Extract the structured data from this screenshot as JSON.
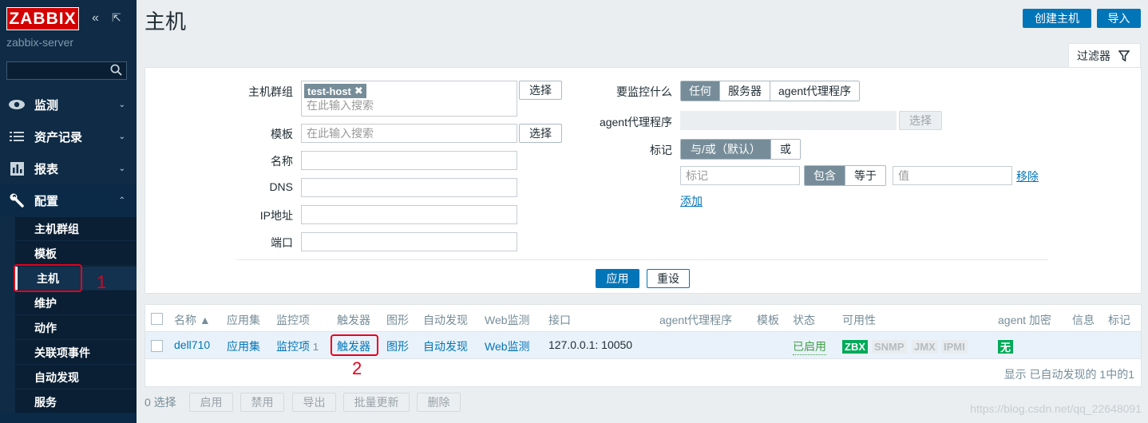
{
  "sidebar": {
    "logo": "ZABBIX",
    "server": "zabbix-server",
    "collapse_icon": "«",
    "expand_icon": "⇱",
    "menu": [
      {
        "label": "监测",
        "icon": "eye-icon"
      },
      {
        "label": "资产记录",
        "icon": "list-icon"
      },
      {
        "label": "报表",
        "icon": "bar-chart-icon"
      },
      {
        "label": "配置",
        "icon": "wrench-icon"
      }
    ],
    "submenu": [
      "主机群组",
      "模板",
      "主机",
      "维护",
      "动作",
      "关联项事件",
      "自动发现",
      "服务"
    ],
    "annotation_1": "1"
  },
  "header": {
    "title": "主机",
    "create_button": "创建主机",
    "import_button": "导入",
    "filter_tab": "过滤器"
  },
  "filter": {
    "hostgroup_label": "主机群组",
    "hostgroup_tag": "test-host",
    "hostgroup_placeholder": "在此输入搜索",
    "select_button": "选择",
    "template_label": "模板",
    "template_placeholder": "在此输入搜索",
    "name_label": "名称",
    "dns_label": "DNS",
    "ip_label": "IP地址",
    "port_label": "端口",
    "monitored_by_label": "要监控什么",
    "monitored_by_options": [
      "任何",
      "服务器",
      "agent代理程序"
    ],
    "proxy_label": "agent代理程序",
    "proxy_select": "选择",
    "tags_label": "标记",
    "tag_mode_options": [
      "与/或（默认）",
      "或"
    ],
    "tag_placeholder": "标记",
    "tag_op_options": [
      "包含",
      "等于"
    ],
    "value_placeholder": "值",
    "remove_link": "移除",
    "add_link": "添加",
    "apply_button": "应用",
    "reset_button": "重设"
  },
  "table": {
    "headers": [
      "名称 ▲",
      "应用集",
      "监控项",
      "触发器",
      "图形",
      "自动发现",
      "Web监测",
      "接口",
      "agent代理程序",
      "模板",
      "状态",
      "可用性",
      "agent 加密",
      "信息",
      "标记"
    ],
    "row": {
      "name": "dell710",
      "apps": "应用集",
      "items": "监控项",
      "items_count": "1",
      "triggers": "触发器",
      "graphs": "图形",
      "discovery": "自动发现",
      "web": "Web监测",
      "interface": "127.0.0.1: 10050",
      "status": "已启用",
      "availability": [
        "ZBX",
        "SNMP",
        "JMX",
        "IPMI"
      ],
      "encryption": "无"
    },
    "summary": "显示 已自动发现的 1中的1",
    "annotation_2": "2"
  },
  "footer": {
    "selected": "0 选择",
    "buttons": [
      "启用",
      "禁用",
      "导出",
      "批量更新",
      "删除"
    ]
  },
  "watermark": "https://blog.csdn.net/qq_22648091",
  "colors": {
    "brand": "#d40000",
    "accent": "#0275b8",
    "zbx_green": "#00aa58",
    "status_green": "#429e47",
    "annotation": "#e8001c"
  }
}
